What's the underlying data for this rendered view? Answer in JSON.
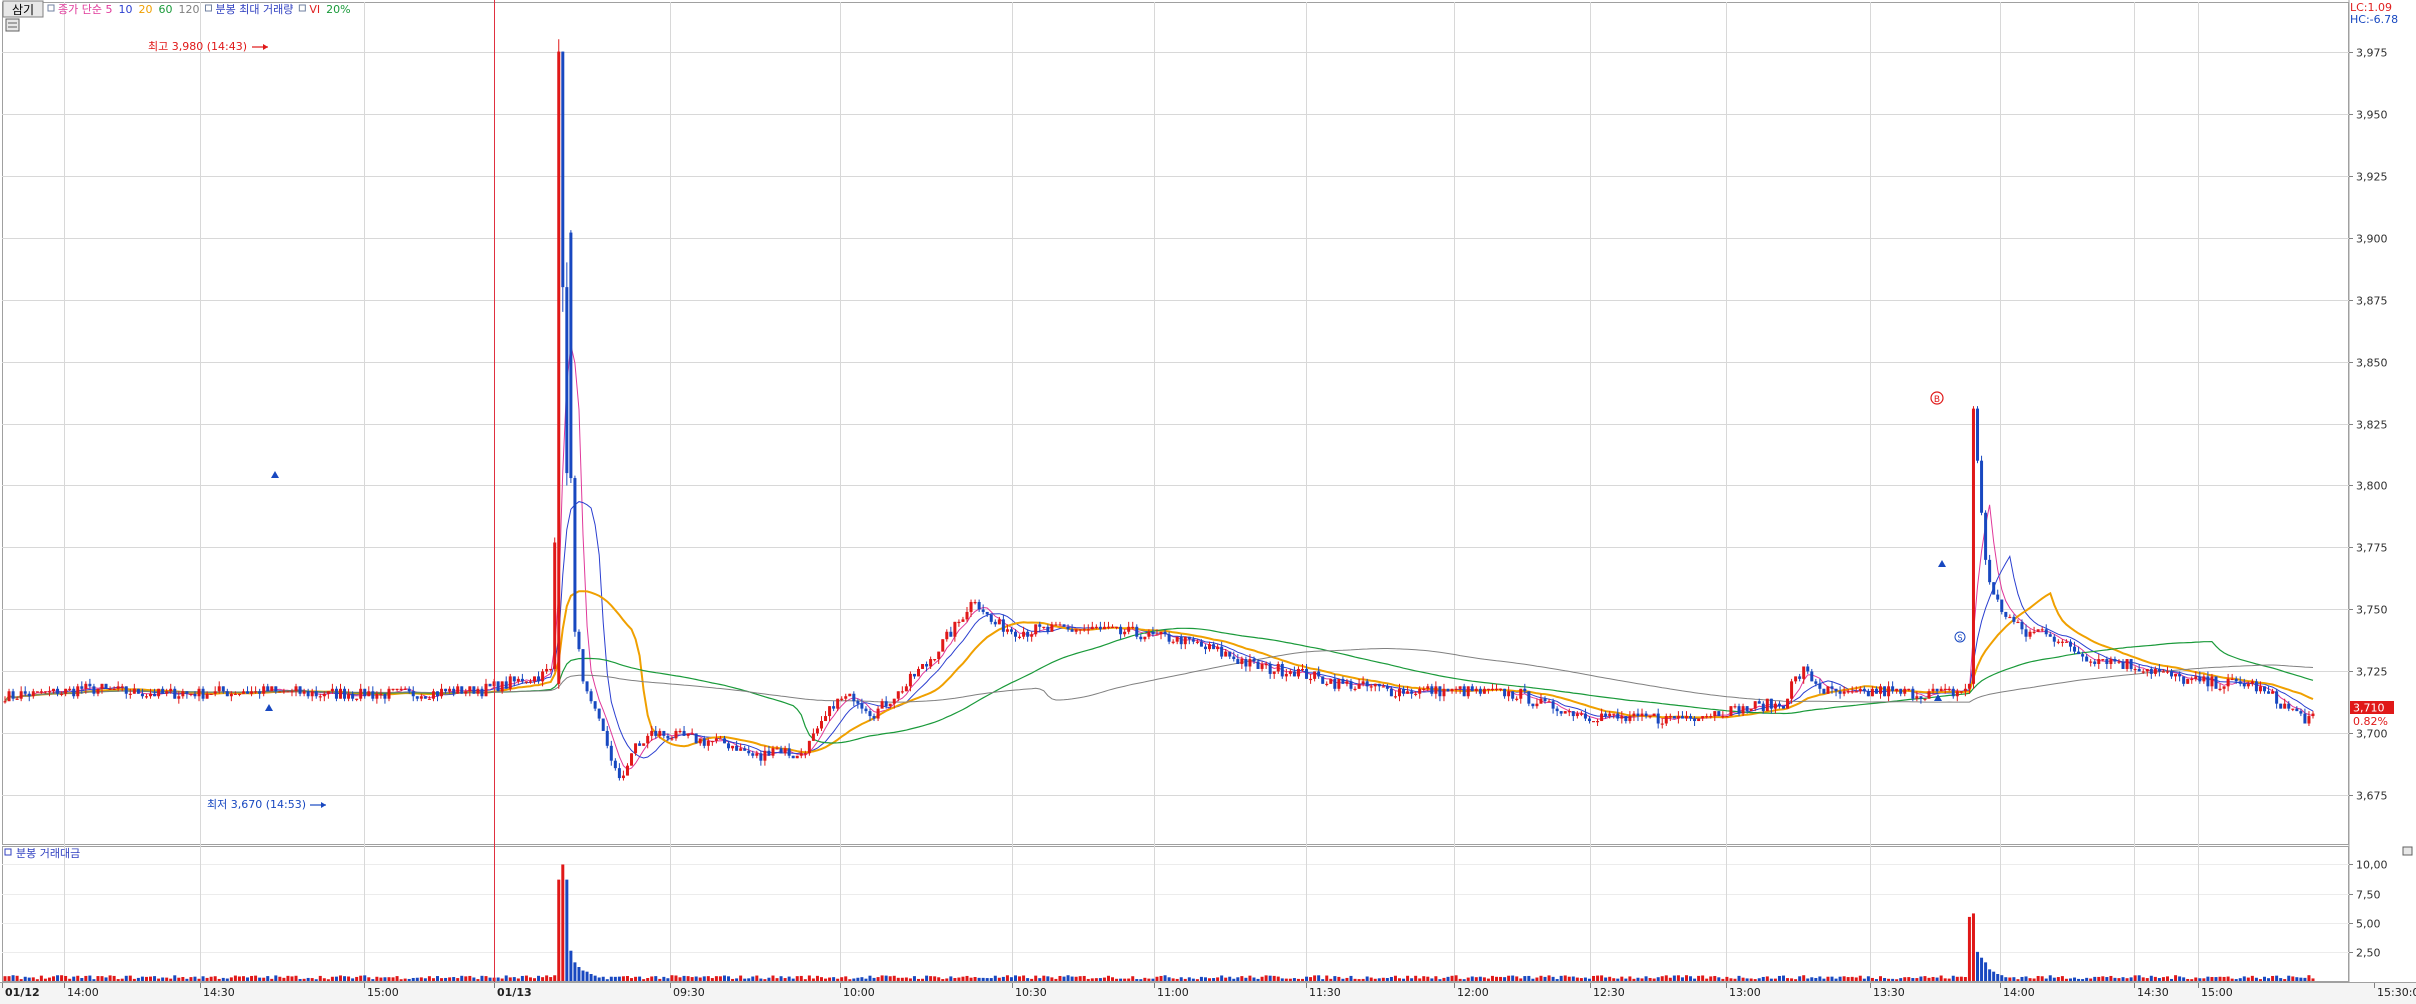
{
  "toolbar": {
    "mode_button": "삼기",
    "legend_items": [
      {
        "label": "종가 단순 5",
        "color": "#e0389a",
        "marker": "■"
      },
      {
        "label": "10",
        "color": "#2b3fd0"
      },
      {
        "label": "20",
        "color": "#f0a000"
      },
      {
        "label": "60",
        "color": "#1a9a3a"
      },
      {
        "label": "120",
        "color": "#808080"
      },
      {
        "label": "분봉 최대 거래량",
        "color": "#3040c0",
        "marker": "■"
      },
      {
        "label": "VI",
        "color": "#e02020",
        "marker": "■"
      },
      {
        "label": "20%",
        "color": "#1a9a3a"
      }
    ]
  },
  "indicators": {
    "lc": "LC:1.09",
    "hc": "HC:-6.78"
  },
  "current_price": {
    "value": "3,710",
    "change": "0.82%"
  },
  "annotations": {
    "high_label": "최고 3,980 (14:43)",
    "low_label": "최저 3,670 (14:53)",
    "vi_badge": "B",
    "s_badge": "S"
  },
  "volume_panel": {
    "title": "분봉 거래대금"
  },
  "colors": {
    "up": "#e01818",
    "down": "#1848c0",
    "ma5": "#e0389a",
    "ma10": "#2b3fd0",
    "ma20": "#f0a000",
    "ma60": "#1a9a3a",
    "ma120": "#808080",
    "grid": "#d8d8d8"
  },
  "chart_data": {
    "type": "candlestick",
    "price_axis": {
      "ticks": [
        "3,675",
        "3,700",
        "3,725",
        "3,750",
        "3,775",
        "3,800",
        "3,825",
        "3,850",
        "3,875",
        "3,900",
        "3,925",
        "3,950",
        "3,975"
      ],
      "range": [
        3655,
        3995
      ]
    },
    "volume_axis": {
      "ticks": [
        "2,50",
        "5,00",
        "7,50",
        "10,00"
      ],
      "range": [
        0,
        11.5
      ]
    },
    "time_axis": {
      "labels": [
        "01/12",
        "14:00",
        "14:30",
        "15:00",
        "01/13",
        "09:30",
        "10:00",
        "10:30",
        "11:00",
        "11:30",
        "12:00",
        "12:30",
        "13:00",
        "13:30",
        "14:00",
        "14:30",
        "15:00",
        "15:30:00"
      ]
    },
    "anchors": [
      [
        0,
        3715
      ],
      [
        20,
        3718
      ],
      [
        40,
        3716
      ],
      [
        60,
        3717
      ],
      [
        80,
        3716
      ],
      [
        100,
        3716
      ],
      [
        120,
        3718
      ],
      [
        135,
        3725
      ],
      [
        137,
        3830
      ],
      [
        138,
        3975
      ],
      [
        139,
        3900
      ],
      [
        140,
        3805
      ],
      [
        141,
        3740
      ],
      [
        144,
        3715
      ],
      [
        148,
        3700
      ],
      [
        150,
        3690
      ],
      [
        152,
        3680
      ],
      [
        155,
        3692
      ],
      [
        160,
        3700
      ],
      [
        170,
        3698
      ],
      [
        180,
        3695
      ],
      [
        187,
        3690
      ],
      [
        190,
        3695
      ],
      [
        196,
        3690
      ],
      [
        201,
        3700
      ],
      [
        205,
        3712
      ],
      [
        210,
        3715
      ],
      [
        215,
        3708
      ],
      [
        222,
        3718
      ],
      [
        228,
        3728
      ],
      [
        236,
        3745
      ],
      [
        240,
        3755
      ],
      [
        244,
        3745
      ],
      [
        250,
        3741
      ],
      [
        260,
        3742
      ],
      [
        270,
        3742
      ],
      [
        280,
        3740
      ],
      [
        290,
        3738
      ],
      [
        300,
        3733
      ],
      [
        310,
        3727
      ],
      [
        320,
        3725
      ],
      [
        330,
        3720
      ],
      [
        345,
        3717
      ],
      [
        360,
        3717
      ],
      [
        375,
        3716
      ],
      [
        380,
        3712
      ],
      [
        390,
        3708
      ],
      [
        400,
        3706
      ],
      [
        410,
        3706
      ],
      [
        420,
        3708
      ],
      [
        430,
        3710
      ],
      [
        440,
        3712
      ],
      [
        442,
        3720
      ],
      [
        445,
        3725
      ],
      [
        450,
        3717
      ],
      [
        456,
        3715
      ],
      [
        464,
        3717
      ],
      [
        474,
        3716
      ],
      [
        484,
        3717
      ],
      [
        486,
        3720
      ],
      [
        487,
        3830
      ],
      [
        488,
        3810
      ],
      [
        490,
        3770
      ],
      [
        492,
        3755
      ],
      [
        495,
        3748
      ],
      [
        500,
        3740
      ],
      [
        505,
        3742
      ],
      [
        510,
        3735
      ],
      [
        515,
        3731
      ],
      [
        520,
        3730
      ],
      [
        525,
        3728
      ],
      [
        532,
        3725
      ],
      [
        540,
        3721
      ],
      [
        548,
        3720
      ],
      [
        556,
        3720
      ],
      [
        563,
        3712
      ],
      [
        566,
        3709
      ],
      [
        570,
        3706
      ]
    ],
    "big_candles": [
      [
        137,
        3720,
        3980,
        3718,
        3975
      ],
      [
        138,
        3975,
        3975,
        3870,
        3880
      ],
      [
        139,
        3880,
        3890,
        3800,
        3805
      ]
    ],
    "volume_spikes": {
      "137": 8.7,
      "138": 10.0,
      "139": 8.7,
      "140": 2.6,
      "141": 1.6,
      "142": 1.2,
      "143": 0.9,
      "144": 0.8,
      "145": 0.6,
      "486": 5.5,
      "487": 5.8,
      "488": 2.5,
      "489": 2.0,
      "490": 1.6,
      "491": 1.0,
      "492": 0.8,
      "493": 0.6,
      "494": 0.5
    }
  }
}
